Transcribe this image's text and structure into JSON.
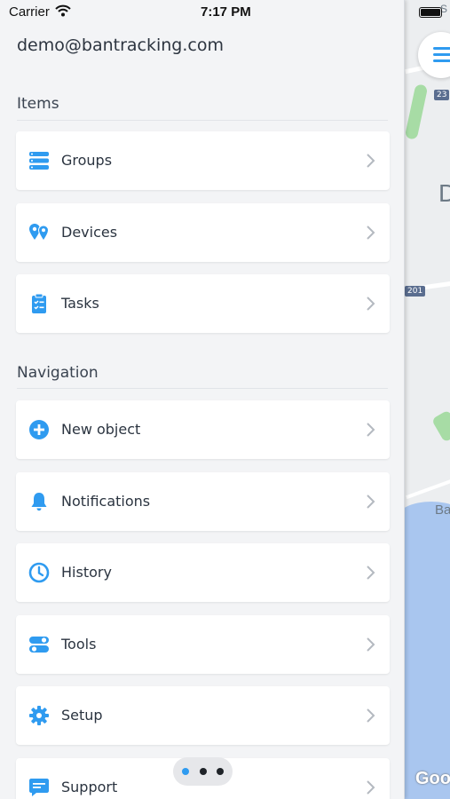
{
  "status_bar": {
    "carrier": "Carrier",
    "time": "7:17 PM"
  },
  "account": {
    "email": "demo@bantracking.com"
  },
  "sections": {
    "items": {
      "title": "Items",
      "entries": [
        {
          "label": "Groups",
          "icon": "list-stack-icon"
        },
        {
          "label": "Devices",
          "icon": "map-pins-icon"
        },
        {
          "label": "Tasks",
          "icon": "clipboard-icon"
        }
      ]
    },
    "navigation": {
      "title": "Navigation",
      "entries": [
        {
          "label": "New object",
          "icon": "plus-circle-icon"
        },
        {
          "label": "Notifications",
          "icon": "bell-icon"
        },
        {
          "label": "History",
          "icon": "clock-icon"
        },
        {
          "label": "Tools",
          "icon": "toggles-icon"
        },
        {
          "label": "Setup",
          "icon": "gear-icon"
        },
        {
          "label": "Support",
          "icon": "chat-icon"
        }
      ]
    }
  },
  "map": {
    "shields": [
      "23",
      "201"
    ],
    "labels": [
      "S",
      "D",
      "Ba"
    ],
    "attribution": "Goo"
  },
  "colors": {
    "accent": "#2f9bf0",
    "text": "#2b3440",
    "background": "#f3f4f6"
  }
}
